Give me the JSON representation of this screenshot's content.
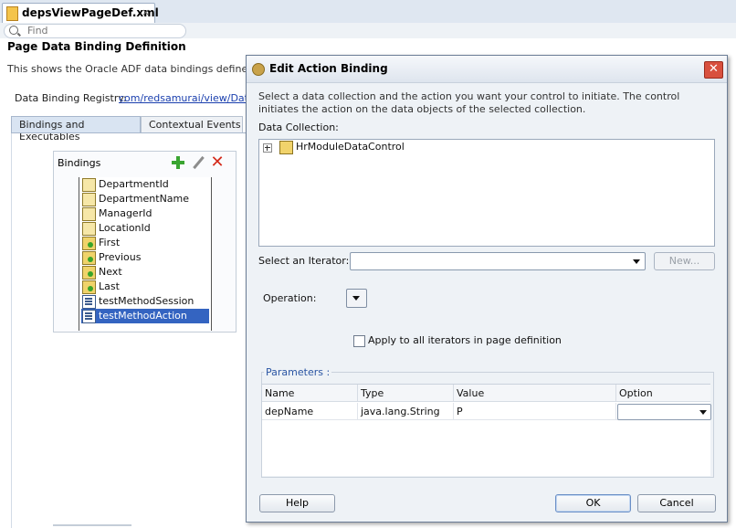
{
  "editor": {
    "tab_label": "depsViewPageDef.xml",
    "tab_close": "×",
    "find_placeholder": "Find",
    "page_title": "Page Data Binding Definition",
    "page_description": "This shows the Oracle ADF data bindings defined for y",
    "registry_label": "Data Binding Registry:",
    "registry_link": "com/redsamurai/view/DataBi",
    "tabs": [
      "Bindings and Executables",
      "Contextual Events"
    ]
  },
  "bindings": {
    "title": "Bindings",
    "items": [
      {
        "label": "DepartmentId",
        "icon": "attribute-binding-icon"
      },
      {
        "label": "DepartmentName",
        "icon": "attribute-binding-icon"
      },
      {
        "label": "ManagerId",
        "icon": "attribute-binding-icon"
      },
      {
        "label": "LocationId",
        "icon": "attribute-binding-icon"
      },
      {
        "label": "First",
        "icon": "action-binding-icon"
      },
      {
        "label": "Previous",
        "icon": "action-binding-icon"
      },
      {
        "label": "Next",
        "icon": "action-binding-icon"
      },
      {
        "label": "Last",
        "icon": "action-binding-icon"
      },
      {
        "label": "testMethodSession",
        "icon": "method-binding-icon"
      },
      {
        "label": "testMethodAction",
        "icon": "method-binding-icon",
        "selected": true
      }
    ]
  },
  "dialog": {
    "title": "Edit Action Binding",
    "instructions": "Select a data collection and the action you want your control to initiate. The control initiates the action on the data objects of the selected collection.",
    "data_collection_label": "Data Collection:",
    "tree_root": "HrModuleDataControl",
    "iterator_label": "Select an Iterator:",
    "iterator_value": "",
    "new_button": "New...",
    "operation_label": "Operation:",
    "apply_label": "Apply to all iterators in page definition",
    "apply_checked": false,
    "parameters_label": "Parameters :",
    "columns": [
      "Name",
      "Type",
      "Value",
      "Option"
    ],
    "rows": [
      {
        "name": "depName",
        "type": "java.lang.String",
        "value": "P",
        "option": ""
      }
    ],
    "help_button": "Help",
    "ok_button": "OK",
    "cancel_button": "Cancel"
  },
  "colors": {
    "selection": "#3464c1",
    "link": "#1a3fae",
    "group_label": "#2a55a3",
    "close_button": "#d8503e"
  }
}
